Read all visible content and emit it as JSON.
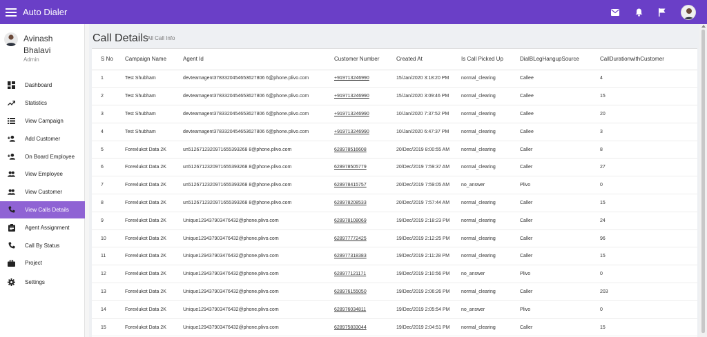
{
  "app": {
    "title": "Auto Dialer"
  },
  "user": {
    "name": "Avinash Bhalavi",
    "role": "Admin"
  },
  "topbar": {
    "icons": [
      "mail-icon",
      "bell-icon",
      "flag-icon",
      "avatar"
    ]
  },
  "colors": {
    "primary": "#6a3fc7",
    "active_nav": "#8f63d4"
  },
  "sidebar": {
    "items": [
      {
        "label": "Dashboard",
        "icon": "dashboard-icon",
        "active": false
      },
      {
        "label": "Statistics",
        "icon": "trending-up-icon",
        "active": false
      },
      {
        "label": "View Campaign",
        "icon": "list-icon",
        "active": false
      },
      {
        "label": "Add Customer",
        "icon": "person-add-icon",
        "active": false
      },
      {
        "label": "On Board Employee",
        "icon": "person-add-icon",
        "active": false
      },
      {
        "label": "View Employee",
        "icon": "people-icon",
        "active": false
      },
      {
        "label": "View Customer",
        "icon": "people-icon",
        "active": false
      },
      {
        "label": "View Calls Details",
        "icon": "phone-icon",
        "active": true
      },
      {
        "label": "Agent Assignment",
        "icon": "clipboard-icon",
        "active": false
      },
      {
        "label": "Call By Status",
        "icon": "phone-icon",
        "active": false
      },
      {
        "label": "Project",
        "icon": "briefcase-icon",
        "active": false
      },
      {
        "label": "Settings",
        "icon": "gear-icon",
        "active": false
      }
    ]
  },
  "page": {
    "title": "Call Details",
    "subtitle": "All Call Info"
  },
  "table": {
    "columns": [
      "S No",
      "Campaign Name",
      "Agent Id",
      "Customer Number",
      "Created At",
      "Is Call Picked Up",
      "DialBLegHangupSource",
      "CallDurationwithCustomer"
    ],
    "rows": [
      [
        "1",
        "Test Shubham",
        "devteamagent3783320454653627806 6@phone.plivo.com",
        "+919713246990",
        "15/Jan/2020 3:18:20 PM",
        "normal_clearing",
        "Callee",
        "4"
      ],
      [
        "2",
        "Test Shubham",
        "devteamagent3783320454653627806 6@phone.plivo.com",
        "+919713246990",
        "15/Jan/2020 3:09:46 PM",
        "normal_clearing",
        "Callee",
        "15"
      ],
      [
        "3",
        "Test Shubham",
        "devteamagent3783320454653627806 6@phone.plivo.com",
        "+919713246990",
        "10/Jan/2020 7:37:52 PM",
        "normal_clearing",
        "Callee",
        "20"
      ],
      [
        "4",
        "Test Shubham",
        "devteamagent3783320454653627806 6@phone.plivo.com",
        "+919713246990",
        "10/Jan/2020 6:47:37 PM",
        "normal_clearing",
        "Callee",
        "3"
      ],
      [
        "5",
        "Forexlukot Data 2K",
        "un5126712320971655393268 8@phone.plivo.com",
        "628978516608",
        "20/Dec/2019 8:00:55 AM",
        "normal_clearing",
        "Caller",
        "8"
      ],
      [
        "6",
        "Forexlukot Data 2K",
        "un5126712320971655393268 8@phone.plivo.com",
        "628978505779",
        "20/Dec/2019 7:59:37 AM",
        "normal_clearing",
        "Caller",
        "27"
      ],
      [
        "7",
        "Forexlukot Data 2K",
        "un5126712320971655393268 8@phone.plivo.com",
        "628978415757",
        "20/Dec/2019 7:59:05 AM",
        "no_answer",
        "Plivo",
        "0"
      ],
      [
        "8",
        "Forexlukot Data 2K",
        "un5126712320971655393268 8@phone.plivo.com",
        "628978208533",
        "20/Dec/2019 7:57:44 AM",
        "normal_clearing",
        "Caller",
        "15"
      ],
      [
        "9",
        "Forexlukot Data 2K",
        "Unique129437903476432@phone.plivo.com",
        "628978108069",
        "19/Dec/2019 2:18:23 PM",
        "normal_clearing",
        "Caller",
        "24"
      ],
      [
        "10",
        "Forexlukot Data 2K",
        "Unique129437903476432@phone.plivo.com",
        "628977772425",
        "19/Dec/2019 2:12:25 PM",
        "normal_clearing",
        "Caller",
        "96"
      ],
      [
        "11",
        "Forexlukot Data 2K",
        "Unique129437903476432@phone.plivo.com",
        "628977318383",
        "19/Dec/2019 2:11:28 PM",
        "normal_clearing",
        "Caller",
        "15"
      ],
      [
        "12",
        "Forexlukot Data 2K",
        "Unique129437903476432@phone.plivo.com",
        "628977121171",
        "19/Dec/2019 2:10:56 PM",
        "no_answer",
        "Plivo",
        "0"
      ],
      [
        "13",
        "Forexlukot Data 2K",
        "Unique129437903476432@phone.plivo.com",
        "628976155050",
        "19/Dec/2019 2:06:26 PM",
        "normal_clearing",
        "Caller",
        "203"
      ],
      [
        "14",
        "Forexlukot Data 2K",
        "Unique129437903476432@phone.plivo.com",
        "628976034811",
        "19/Dec/2019 2:05:54 PM",
        "no_answer",
        "Plivo",
        "0"
      ],
      [
        "15",
        "Forexlukot Data 2K",
        "Unique129437903476432@phone.plivo.com",
        "628975833044",
        "19/Dec/2019 2:04:51 PM",
        "normal_clearing",
        "Caller",
        "15"
      ]
    ]
  }
}
